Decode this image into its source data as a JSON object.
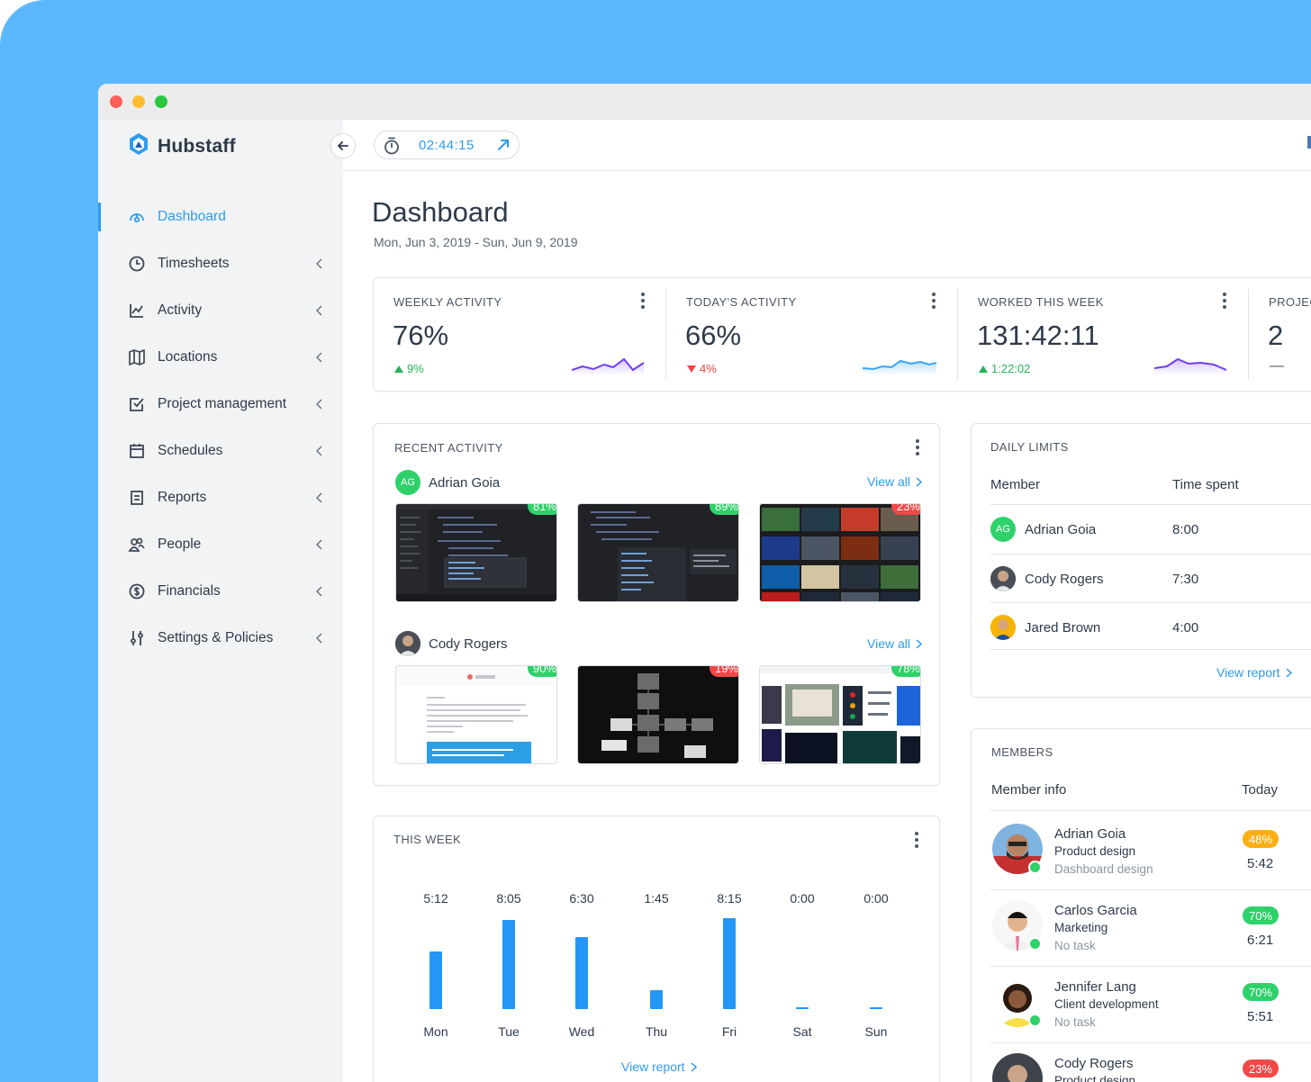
{
  "app": {
    "name": "Hubstaff"
  },
  "colors": {
    "accent": "#2d9cef",
    "positive": "#24b35a",
    "negative": "#ef4444",
    "background": "#5cb8fd"
  },
  "topbar": {
    "timer": "02:44:15"
  },
  "sidebar": {
    "items": [
      {
        "label": "Dashboard",
        "icon": "dashboard-icon",
        "active": true
      },
      {
        "label": "Timesheets",
        "icon": "clock-icon"
      },
      {
        "label": "Activity",
        "icon": "chart-line-icon"
      },
      {
        "label": "Locations",
        "icon": "map-icon"
      },
      {
        "label": "Project management",
        "icon": "checkbox-icon"
      },
      {
        "label": "Schedules",
        "icon": "calendar-icon"
      },
      {
        "label": "Reports",
        "icon": "report-icon"
      },
      {
        "label": "People",
        "icon": "people-icon"
      },
      {
        "label": "Financials",
        "icon": "dollar-icon"
      },
      {
        "label": "Settings & Policies",
        "icon": "sliders-icon"
      }
    ]
  },
  "page": {
    "title": "Dashboard",
    "date_range": "Mon, Jun 3, 2019 - Sun, Jun 9, 2019"
  },
  "stats": [
    {
      "label": "WEEKLY ACTIVITY",
      "value": "76%",
      "delta": "9%",
      "direction": "up"
    },
    {
      "label": "TODAY'S ACTIVITY",
      "value": "66%",
      "delta": "4%",
      "direction": "down"
    },
    {
      "label": "WORKED THIS WEEK",
      "value": "131:42:11",
      "delta": "1:22:02",
      "direction": "up"
    },
    {
      "label": "PROJEC",
      "value": "2",
      "delta": "—"
    }
  ],
  "recent_activity": {
    "title": "RECENT ACTIVITY",
    "view_all": "View all",
    "members": [
      {
        "name": "Adrian Goia",
        "initials": "AG",
        "shots": [
          {
            "pct": "81%",
            "level": "green"
          },
          {
            "pct": "89%",
            "level": "green"
          },
          {
            "pct": "23%",
            "level": "red"
          }
        ]
      },
      {
        "name": "Cody Rogers",
        "shots": [
          {
            "pct": "90%",
            "level": "green"
          },
          {
            "pct": "19%",
            "level": "red"
          },
          {
            "pct": "78%",
            "level": "green"
          }
        ]
      }
    ]
  },
  "this_week": {
    "title": "THIS WEEK",
    "view_report": "View report"
  },
  "chart_data": {
    "type": "bar",
    "categories": [
      "Mon",
      "Tue",
      "Wed",
      "Thu",
      "Fri",
      "Sat",
      "Sun"
    ],
    "labels": [
      "5:12",
      "8:05",
      "6:30",
      "1:45",
      "8:15",
      "0:00",
      "0:00"
    ],
    "values": [
      5.2,
      8.083,
      6.5,
      1.75,
      8.25,
      0,
      0
    ],
    "ylim": [
      0,
      8.25
    ],
    "grid": false
  },
  "daily_limits": {
    "title": "DAILY LIMITS",
    "col_member": "Member",
    "col_time": "Time spent",
    "rows": [
      {
        "name": "Adrian Goia",
        "initials": "AG",
        "time": "8:00"
      },
      {
        "name": "Cody Rogers",
        "time": "7:30"
      },
      {
        "name": "Jared Brown",
        "time": "4:00"
      }
    ],
    "view_report": "View report"
  },
  "members": {
    "title": "MEMBERS",
    "col_info": "Member info",
    "col_today": "Today",
    "rows": [
      {
        "name": "Adrian Goia",
        "project": "Product design",
        "task": "Dashboard design",
        "pct": "48%",
        "level": "orange",
        "time": "5:42"
      },
      {
        "name": "Carlos Garcia",
        "project": "Marketing",
        "task": "No task",
        "pct": "70%",
        "level": "green",
        "time": "6:21"
      },
      {
        "name": "Jennifer Lang",
        "project": "Client development",
        "task": "No task",
        "pct": "70%",
        "level": "green",
        "time": "5:51"
      },
      {
        "name": "Cody Rogers",
        "project": "Product design",
        "pct": "23%",
        "level": "red"
      }
    ]
  }
}
